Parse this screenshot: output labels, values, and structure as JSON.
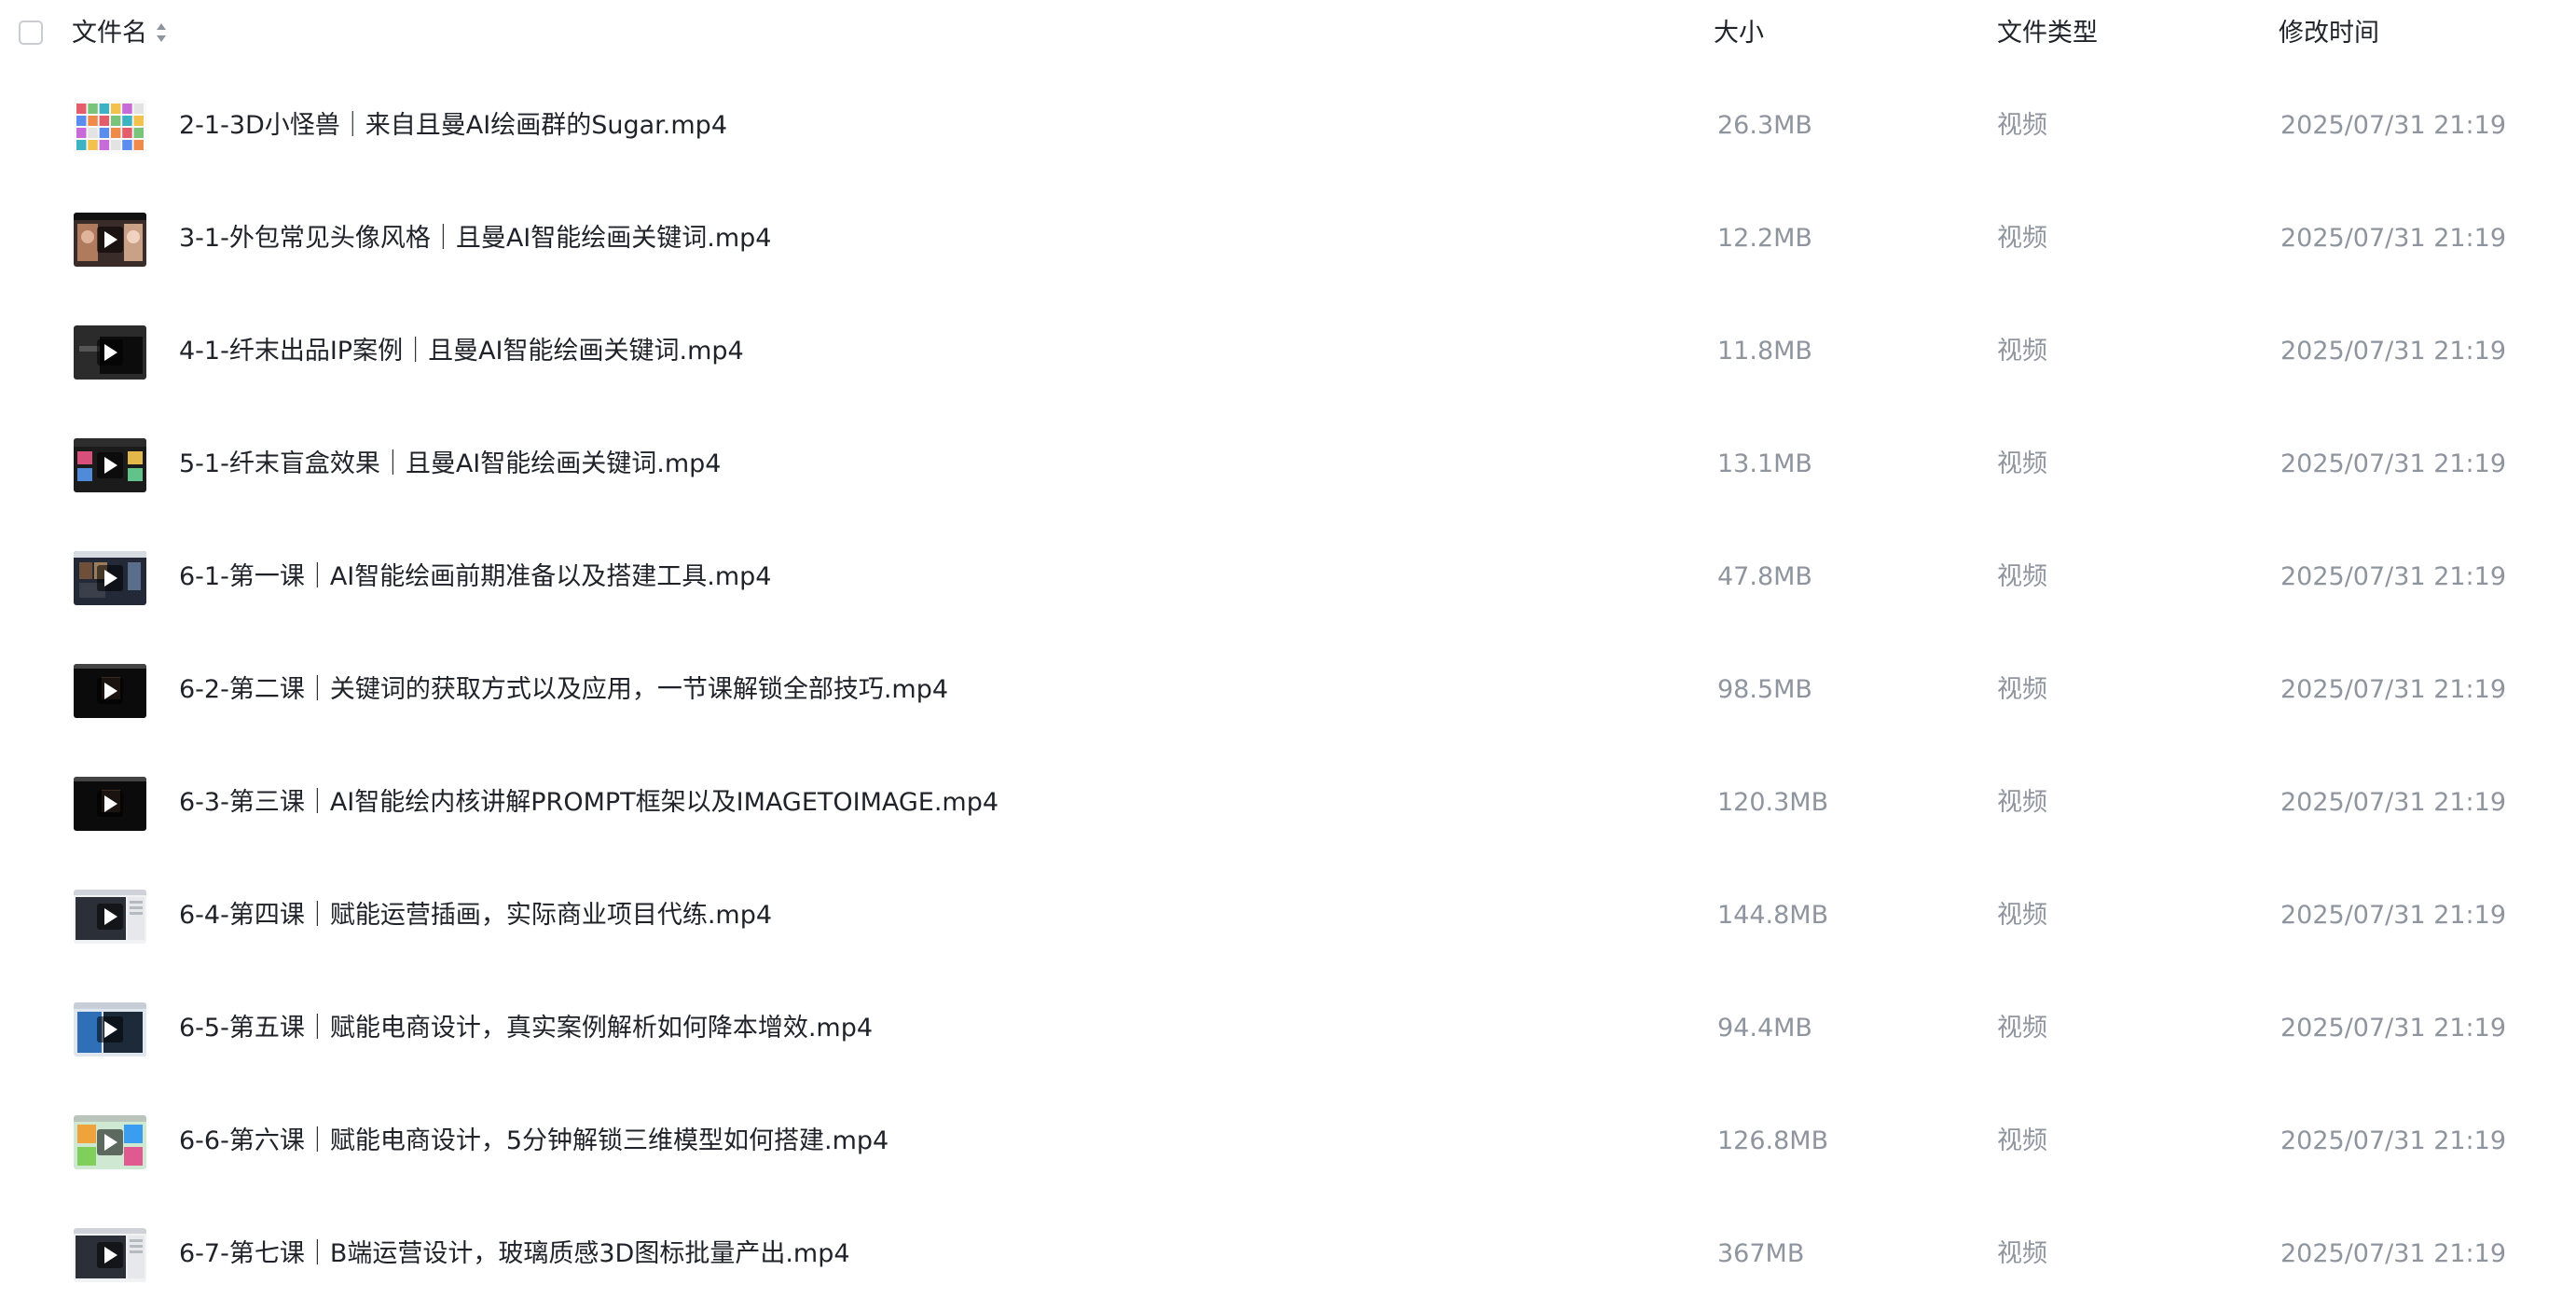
{
  "header": {
    "name": "文件名",
    "size": "大小",
    "type": "文件类型",
    "modified": "修改时间"
  },
  "rows": [
    {
      "name": "2-1-3D小怪兽｜来自且曼AI绘画群的Sugar.mp4",
      "size": "26.3MB",
      "type": "视频",
      "modified": "2025/07/31 21:19",
      "thumb_style": "mosaic"
    },
    {
      "name": "3-1-外包常见头像风格｜且曼AI智能绘画关键词.mp4",
      "size": "12.2MB",
      "type": "视频",
      "modified": "2025/07/31 21:19",
      "thumb_style": "portrait"
    },
    {
      "name": "4-1-纤末出品IP案例｜且曼AI智能绘画关键词.mp4",
      "size": "11.8MB",
      "type": "视频",
      "modified": "2025/07/31 21:19",
      "thumb_style": "dark"
    },
    {
      "name": "5-1-纤末盲盒效果｜且曼AI智能绘画关键词.mp4",
      "size": "13.1MB",
      "type": "视频",
      "modified": "2025/07/31 21:19",
      "thumb_style": "collage"
    },
    {
      "name": "6-1-第一课｜AI智能绘画前期准备以及搭建工具.mp4",
      "size": "47.8MB",
      "type": "视频",
      "modified": "2025/07/31 21:19",
      "thumb_style": "desktop"
    },
    {
      "name": "6-2-第二课｜关键词的获取方式以及应用，一节课解锁全部技巧.mp4",
      "size": "98.5MB",
      "type": "视频",
      "modified": "2025/07/31 21:19",
      "thumb_style": "black"
    },
    {
      "name": "6-3-第三课｜AI智能绘内核讲解PROMPT框架以及IMAGETOIMAGE.mp4",
      "size": "120.3MB",
      "type": "视频",
      "modified": "2025/07/31 21:19",
      "thumb_style": "black"
    },
    {
      "name": "6-4-第四课｜赋能运营插画，实际商业项目代练.mp4",
      "size": "144.8MB",
      "type": "视频",
      "modified": "2025/07/31 21:19",
      "thumb_style": "window"
    },
    {
      "name": "6-5-第五课｜赋能电商设计，真实案例解析如何降本增效.mp4",
      "size": "94.4MB",
      "type": "视频",
      "modified": "2025/07/31 21:19",
      "thumb_style": "blue"
    },
    {
      "name": "6-6-第六课｜赋能电商设计，5分钟解锁三维模型如何搭建.mp4",
      "size": "126.8MB",
      "type": "视频",
      "modified": "2025/07/31 21:19",
      "thumb_style": "colorful"
    },
    {
      "name": "6-7-第七课｜B端运营设计，玻璃质感3D图标批量产出.mp4",
      "size": "367MB",
      "type": "视频",
      "modified": "2025/07/31 21:19",
      "thumb_style": "window"
    }
  ]
}
